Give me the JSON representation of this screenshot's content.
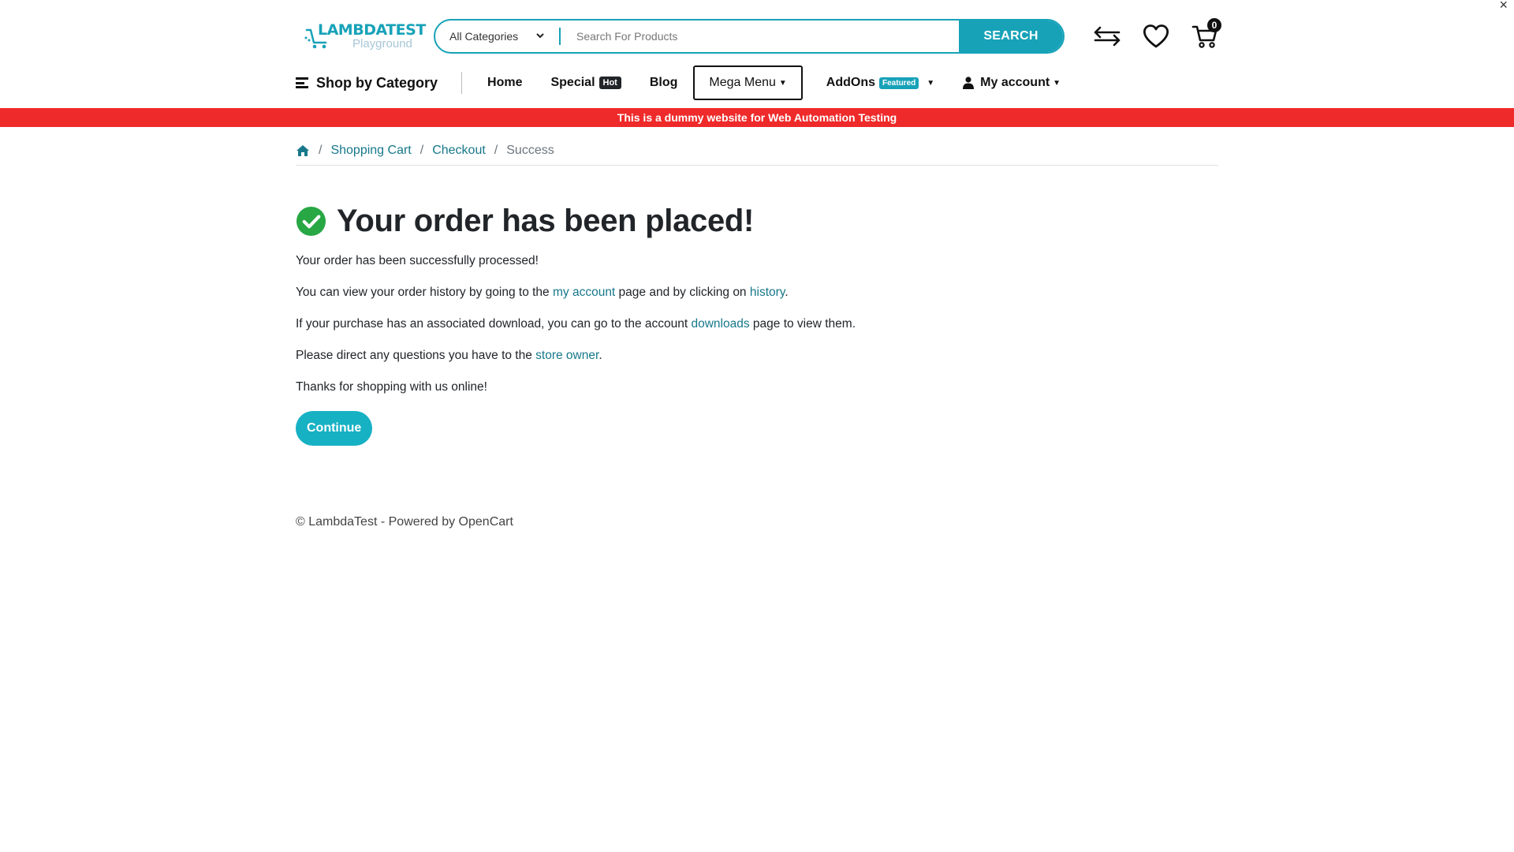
{
  "window": {
    "close_glyph": "×"
  },
  "header": {
    "logo": {
      "brand": "LAMBDATEST",
      "sub": "Playground"
    },
    "search": {
      "category": "All Categories",
      "placeholder": "Search For Products",
      "button_label": "SEARCH"
    },
    "icons": [
      "compare-arrows-icon",
      "heart-icon",
      "cart-icon"
    ],
    "cart_count": "0"
  },
  "nav": {
    "shop_by_category": "Shop by Category",
    "home": "Home",
    "special": "Special",
    "special_badge": "Hot",
    "blog": "Blog",
    "mega_menu": "Mega Menu",
    "addons": "AddOns",
    "addons_badge": "Featured",
    "my_account": "My account"
  },
  "banner": "This is a dummy website for Web Automation Testing",
  "breadcrumb": {
    "items": [
      "Shopping Cart",
      "Checkout"
    ],
    "current": "Success",
    "separator": "/"
  },
  "content": {
    "title": "Your order has been placed!",
    "line1": "Your order has been successfully processed!",
    "line2": {
      "pre": "You can view your order history by going to the ",
      "link1": "my account",
      "mid": " page and by clicking on ",
      "link2": "history",
      "post": "."
    },
    "line3": {
      "pre": "If your purchase has an associated download, you can go to the account ",
      "link": "downloads",
      "post": " page to view them."
    },
    "line4": {
      "pre": "Please direct any questions you have to the ",
      "link": "store owner",
      "post": "."
    },
    "line5": "Thanks for shopping with us online!",
    "continue_label": "Continue"
  },
  "footer": "© LambdaTest - Powered by OpenCart",
  "colors": {
    "accent": "#17a2b8",
    "banner": "#ef2a2a",
    "success": "#28a745",
    "link": "#17788a"
  }
}
